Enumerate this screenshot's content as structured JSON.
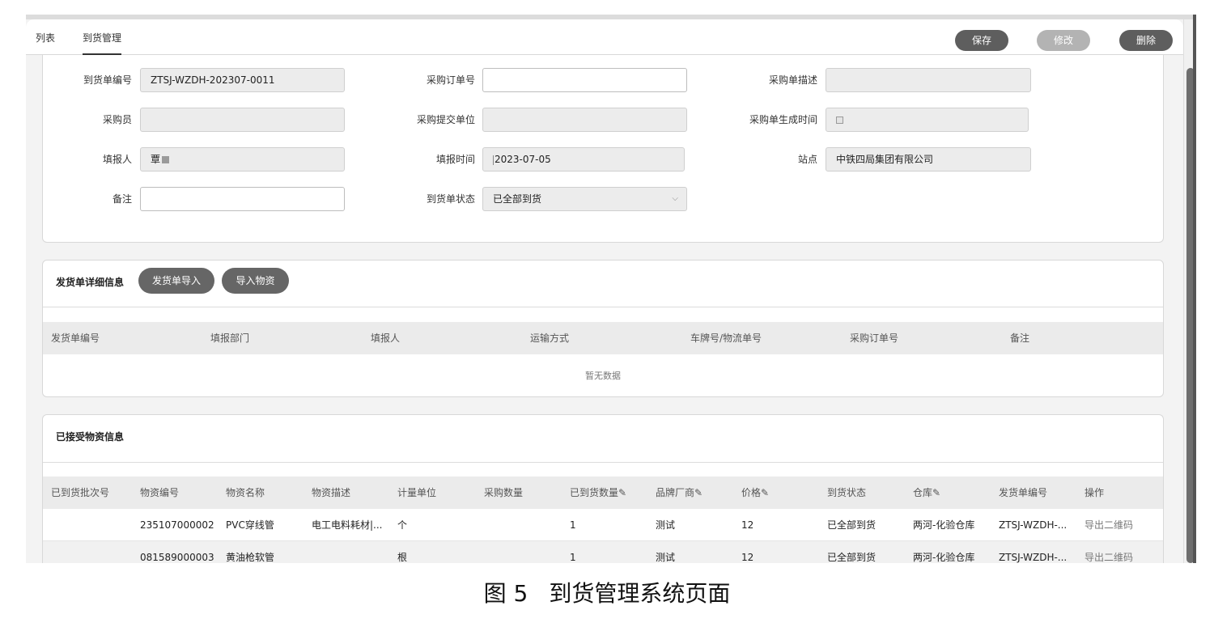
{
  "tabs": [
    {
      "label": "列表"
    },
    {
      "label": "到货管理"
    }
  ],
  "toolbar": {
    "save": "保存",
    "edit": "修改",
    "delete": "删除"
  },
  "form": {
    "arrival_no": {
      "label": "到货单编号",
      "value": "ZTSJ-WZDH-202307-0011"
    },
    "po_no": {
      "label": "采购订单号",
      "value": ""
    },
    "po_desc": {
      "label": "采购单描述",
      "value": ""
    },
    "buyer": {
      "label": "采购员",
      "value": ""
    },
    "po_unit": {
      "label": "采购提交单位",
      "value": ""
    },
    "po_time": {
      "label": "采购单生成时间",
      "value": ""
    },
    "reporter": {
      "label": "填报人",
      "value": "覃"
    },
    "report_time": {
      "label": "填报时间",
      "value": "2023-07-05"
    },
    "station": {
      "label": "站点",
      "value": "中铁四局集团有限公司"
    },
    "remark": {
      "label": "备注",
      "value": ""
    },
    "status": {
      "label": "到货单状态",
      "value": "已全部到货"
    }
  },
  "shipment": {
    "title": "发货单详细信息",
    "import_btn": "发货单导入",
    "import_material_btn": "导入物资",
    "columns": [
      "发货单编号",
      "填报部门",
      "填报人",
      "运输方式",
      "车牌号/物流单号",
      "采购订单号",
      "备注"
    ],
    "empty_text": "暂无数据"
  },
  "received": {
    "title": "已接受物资信息",
    "columns": [
      "已到货批次号",
      "物资编号",
      "物资名称",
      "物资描述",
      "计量单位",
      "采购数量",
      "已到货数量",
      "品牌厂商",
      "价格",
      "到货状态",
      "仓库",
      "发货单编号",
      "操作"
    ],
    "editable_mark": "✎",
    "rows": [
      {
        "batch": "",
        "code": "235107000002",
        "name": "PVC穿线管",
        "desc": "电工电料耗材|...",
        "unit": "个",
        "po_qty": "",
        "arrived_qty": "1",
        "brand": "测试",
        "price": "12",
        "status": "已全部到货",
        "warehouse": "两河-化验仓库",
        "ship_no": "ZTSJ-WZDH-...",
        "action": "导出二维码"
      },
      {
        "batch": "",
        "code": "081589000003",
        "name": "黄油枪软管",
        "desc": "",
        "unit": "根",
        "po_qty": "",
        "arrived_qty": "1",
        "brand": "测试",
        "price": "12",
        "status": "已全部到货",
        "warehouse": "两河-化验仓库",
        "ship_no": "ZTSJ-WZDH-...",
        "action": "导出二维码"
      }
    ]
  },
  "caption": {
    "number": "图 5",
    "text": "到货管理系统页面"
  }
}
